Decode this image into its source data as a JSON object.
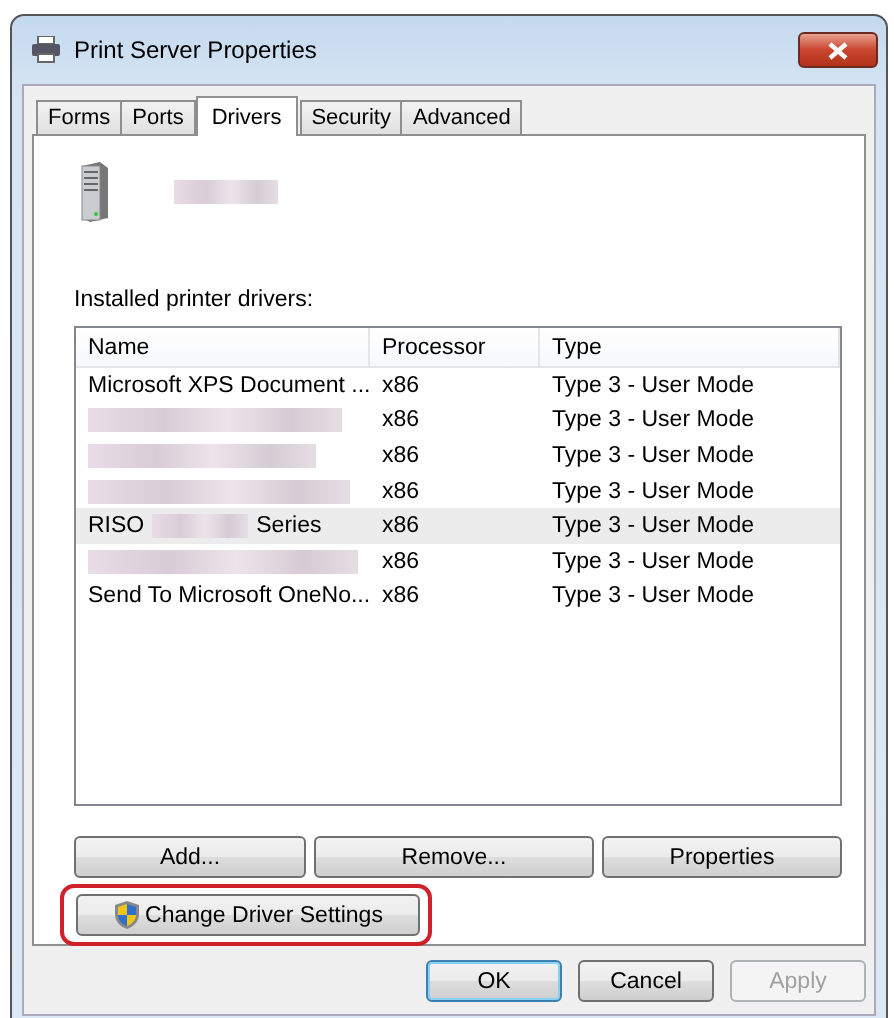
{
  "window": {
    "title": "Print Server Properties"
  },
  "tabs": [
    {
      "label": "Forms",
      "selected": false
    },
    {
      "label": "Ports",
      "selected": false
    },
    {
      "label": "Drivers",
      "selected": true
    },
    {
      "label": "Security",
      "selected": false
    },
    {
      "label": "Advanced",
      "selected": false
    }
  ],
  "server": {
    "name_redacted": true
  },
  "drivers_label": "Installed printer drivers:",
  "table": {
    "columns": [
      "Name",
      "Processor",
      "Type"
    ],
    "rows": [
      {
        "kind": "plain",
        "name": "Microsoft XPS Document ...",
        "processor": "x86",
        "type": "Type 3 - User Mode",
        "selected": false
      },
      {
        "kind": "redacted",
        "processor": "x86",
        "type": "Type 3 - User Mode",
        "selected": false
      },
      {
        "kind": "redacted",
        "processor": "x86",
        "type": "Type 3 - User Mode",
        "selected": false
      },
      {
        "kind": "redacted",
        "processor": "x86",
        "type": "Type 3 - User Mode",
        "selected": false
      },
      {
        "kind": "partial",
        "name_start": "RISO",
        "name_end": "Series",
        "processor": "x86",
        "type": "Type 3 - User Mode",
        "selected": true
      },
      {
        "kind": "redacted",
        "processor": "x86",
        "type": "Type 3 - User Mode",
        "selected": false
      },
      {
        "kind": "plain",
        "name": "Send To Microsoft OneNo...",
        "processor": "x86",
        "type": "Type 3 - User Mode",
        "selected": false
      }
    ]
  },
  "list_buttons": [
    "Add...",
    "Remove...",
    "Properties"
  ],
  "change_settings": {
    "label": "Change Driver Settings",
    "highlighted": true
  },
  "dialog_buttons": [
    {
      "label": "OK",
      "default": true,
      "disabled": false
    },
    {
      "label": "Cancel",
      "default": false,
      "disabled": false
    },
    {
      "label": "Apply",
      "default": false,
      "disabled": true
    }
  ]
}
